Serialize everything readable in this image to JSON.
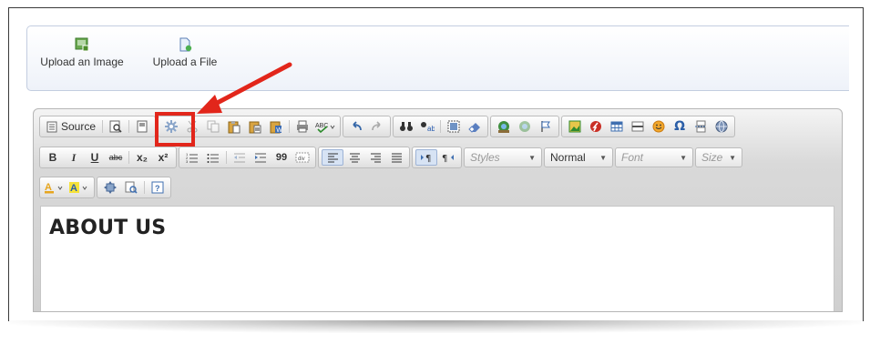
{
  "uploads": {
    "image_label": "Upload an Image",
    "file_label": "Upload a File"
  },
  "toolbar": {
    "row1": {
      "source_label": "Source",
      "icons": [
        "preview-icon",
        "templates-icon",
        "paste-plugin-icon",
        "cut-icon",
        "copy-icon",
        "paste-icon",
        "paste-text-icon",
        "paste-word-icon",
        "print-icon",
        "spellcheck-icon",
        "undo-icon",
        "redo-icon",
        "find-icon",
        "replace-icon",
        "select-all-icon",
        "remove-format-icon",
        "form-icon",
        "hidden-field-icon",
        "anchor-icon",
        "image-icon",
        "flash-icon",
        "table-icon",
        "horizontal-rule-icon",
        "smiley-icon",
        "special-char-icon",
        "page-break-icon",
        "iframe-icon"
      ]
    },
    "row2": {
      "bold": "B",
      "italic": "I",
      "underline": "U",
      "strike": "abc",
      "subscript": "x₂",
      "superscript": "x²",
      "blockquote": "99",
      "styles_placeholder": "Styles",
      "format_value": "Normal",
      "font_placeholder": "Font",
      "size_placeholder": "Size"
    }
  },
  "content": {
    "heading": "ABOUT US"
  },
  "annotation": {
    "color": "#e2261b"
  }
}
